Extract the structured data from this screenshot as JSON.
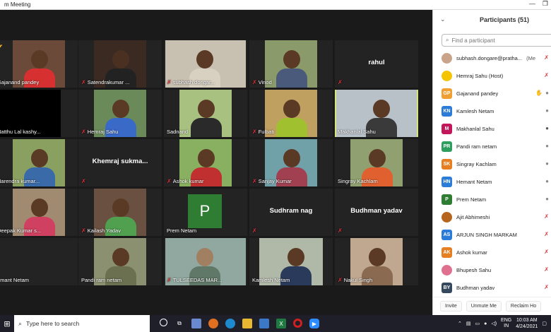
{
  "window": {
    "title": "m Meeting"
  },
  "gallery": {
    "tiles": [
      {
        "name": "Gajanand pandey",
        "muted": false,
        "hand": true
      },
      {
        "name": "Satendrakumar ...",
        "muted": true
      },
      {
        "name": "subhash.dongar...",
        "muted": true
      },
      {
        "name": "Vinod",
        "muted": true
      },
      {
        "name": "rahul",
        "muted": true
      },
      {
        "name": "Natthu Lal kashy...",
        "muted": false
      },
      {
        "name": "Hemraj Sahu",
        "muted": true
      },
      {
        "name": "Sadnand",
        "muted": false
      },
      {
        "name": "Fulbati",
        "muted": true
      },
      {
        "name": "Makhanlal Sahu",
        "muted": false
      },
      {
        "name": "Narendra kumar...",
        "muted": false
      },
      {
        "name": "Khemraj sukma...",
        "muted": true
      },
      {
        "name": "Ashok kumar",
        "muted": true
      },
      {
        "name": "Sanjay Kumar",
        "muted": true
      },
      {
        "name": "Singray Kachlam",
        "muted": false
      },
      {
        "name": "Deepak Kumar s...",
        "muted": false
      },
      {
        "name": "Kailash Yadav",
        "muted": true
      },
      {
        "name": "Prem Netam",
        "muted": false,
        "letter": "P"
      },
      {
        "name": "Sudhram nag",
        "muted": true
      },
      {
        "name": "Budhman yadav",
        "muted": true
      },
      {
        "name": "emant Netam",
        "muted": false
      },
      {
        "name": "Pandi ram netam",
        "muted": false
      },
      {
        "name": "TULSEEDAS MAR...",
        "muted": true
      },
      {
        "name": "Kamlesh Netam",
        "muted": false
      },
      {
        "name": "Nakul Singh",
        "muted": true
      }
    ]
  },
  "participants": {
    "title": "Participants (51)",
    "search_placeholder": "Find a participant",
    "list": [
      {
        "initials": "",
        "name": "subhash.dongare@pratha...",
        "tag": "(Me)",
        "color": "#c9a38a",
        "photo": true,
        "status": "muted"
      },
      {
        "initials": "",
        "name": "Hemraj Sahu (Host)",
        "color": "#f5c400",
        "photo": true,
        "status": "muted"
      },
      {
        "initials": "GP",
        "name": "Gajanand pandey",
        "color": "#f0a030",
        "status": "hand"
      },
      {
        "initials": "KN",
        "name": "Kamlesh Netam",
        "color": "#2b7bd8",
        "status": "mic"
      },
      {
        "initials": "M",
        "name": "Makhanlal Sahu",
        "color": "#c2185b",
        "status": "mic-active"
      },
      {
        "initials": "PR",
        "name": "Pandi ram netam",
        "color": "#2e9e5e",
        "status": "mic"
      },
      {
        "initials": "SK",
        "name": "Singray Kachlam",
        "color": "#e67e22",
        "status": "mic"
      },
      {
        "initials": "HN",
        "name": "Hemant Netam",
        "color": "#2b7bd8",
        "status": "mic"
      },
      {
        "initials": "P",
        "name": "Prem Netam",
        "color": "#2e7d32",
        "status": "mic"
      },
      {
        "initials": "",
        "name": "Ajit Abhimeshi",
        "color": "#b5651d",
        "photo": true,
        "status": "muted"
      },
      {
        "initials": "AS",
        "name": "ARJUN SINGH MARKAM",
        "color": "#2b7bd8",
        "status": "muted"
      },
      {
        "initials": "AK",
        "name": "Ashok kumar",
        "color": "#e67e22",
        "status": "muted"
      },
      {
        "initials": "",
        "name": "Bhupesh Sahu",
        "color": "#e07090",
        "photo": true,
        "status": "muted"
      },
      {
        "initials": "BY",
        "name": "Budhman yadav",
        "color": "#34495e",
        "status": "muted"
      }
    ],
    "buttons": {
      "invite": "Invite",
      "unmute_me": "Unmute Me",
      "reclaim_host": "Reclaim Ho"
    }
  },
  "taskbar": {
    "search_text": "Type here to search",
    "lang_top": "ENG",
    "lang_bottom": "IN",
    "time": "10:03 AM",
    "date": "4/24/2021"
  }
}
